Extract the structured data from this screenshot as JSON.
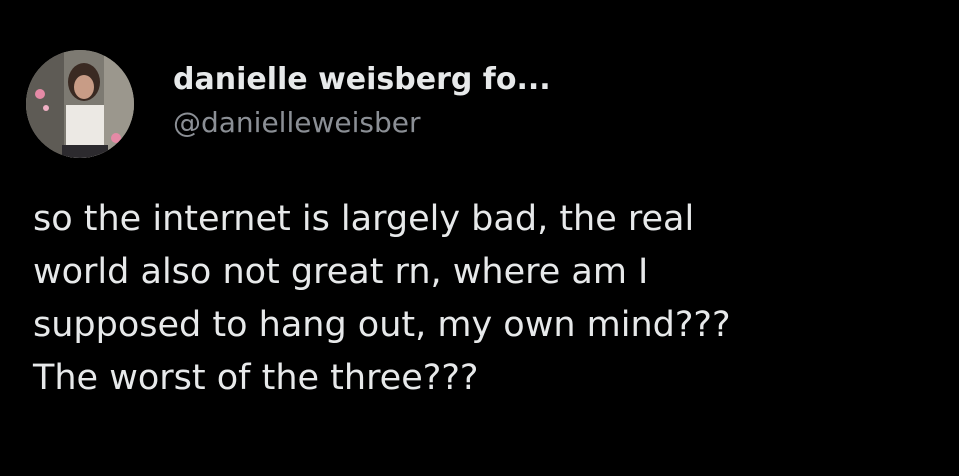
{
  "author": {
    "display_name": "danielle weisberg fo...",
    "handle": "@danielleweisber"
  },
  "avatar_icon": "profile-photo",
  "tweet": {
    "lines": [
      "so the internet is largely bad, the real",
      "world also not great rn, where am I",
      "supposed to hang out, my own mind???",
      "The worst of the three???"
    ]
  },
  "colors": {
    "background": "#000000",
    "text": "#e7e9ea",
    "handle": "#8b8f95"
  }
}
